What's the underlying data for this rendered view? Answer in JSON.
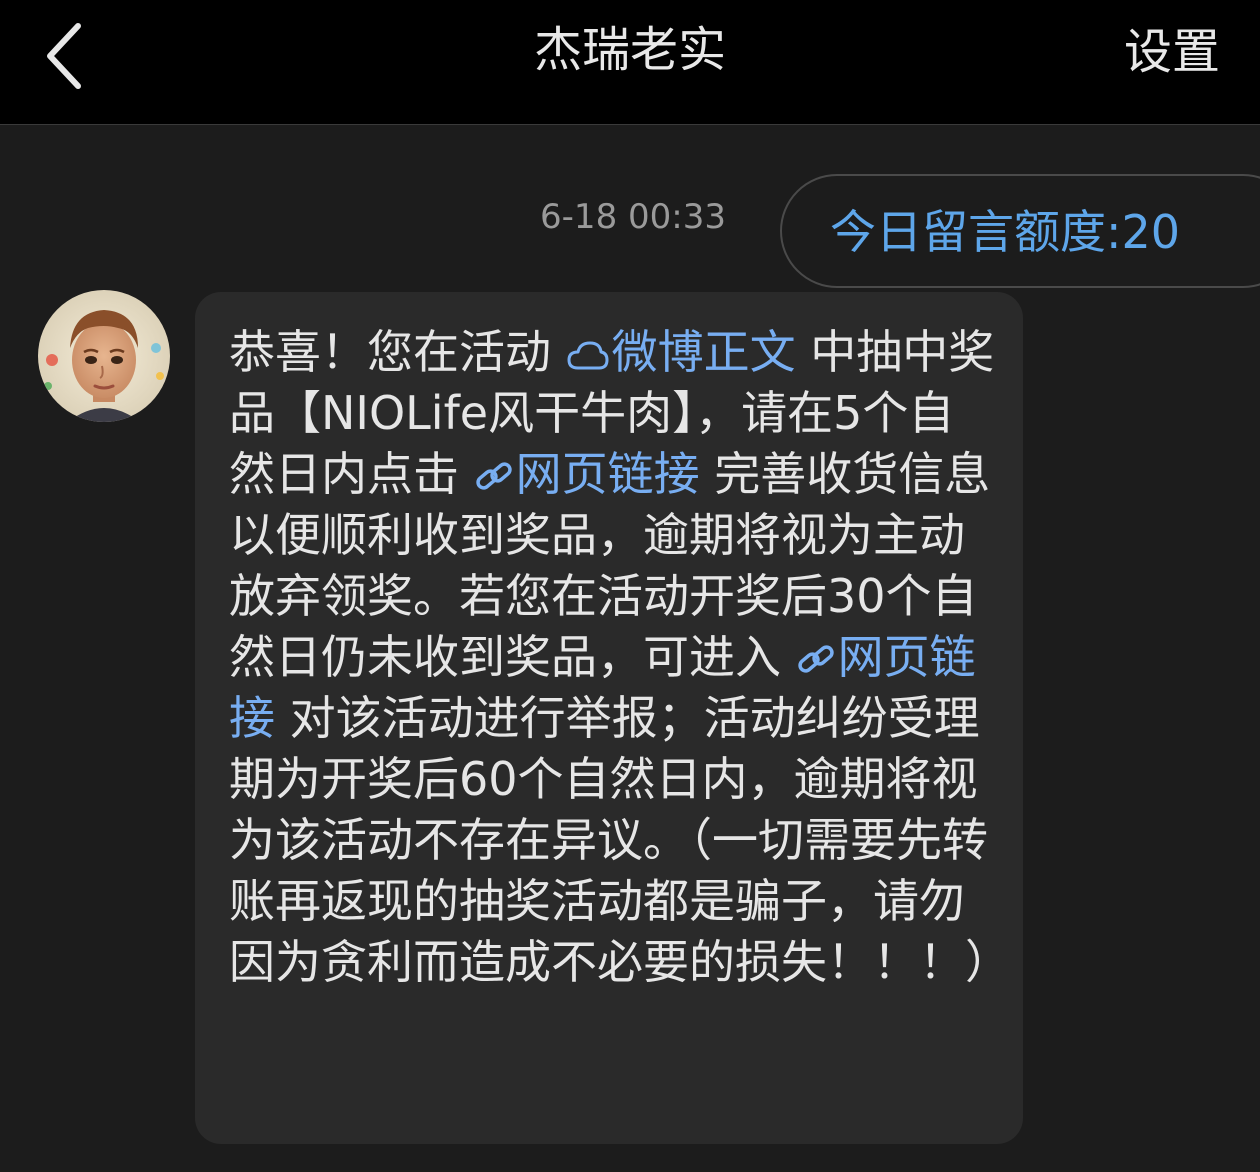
{
  "header": {
    "title": "杰瑞老实",
    "settings_label": "设置",
    "back_icon": "chevron-left-icon"
  },
  "chat": {
    "timestamp": "6-18 00:33",
    "quota_label": "今日留言额度:20",
    "message": {
      "p1": "恭喜！您在活动",
      "link1": "微博正文",
      "p2": "中抽中奖品【NIOLife风干牛肉】，请在5个自然日内点击",
      "link2": "网页链接",
      "p3": "完善收货信息以便顺利收到奖品，逾期将视为主动放弃领奖。若您在活动开奖后30个自然日仍未收到奖品，可进入",
      "link3": "网页链接",
      "p4": "对该活动进行举报；活动纠纷受理期为开奖后60个自然日内，逾期将视为该活动不存在异议。（一切需要先转账再返现的抽奖活动都是骗子，请勿因为贪利而造成不必要的损失！！！）"
    }
  },
  "colors": {
    "background": "#1c1c1c",
    "header_bg": "#000000",
    "bubble_bg": "#2a2a2a",
    "link": "#78aef2",
    "quota_text": "#5ea6ea"
  }
}
